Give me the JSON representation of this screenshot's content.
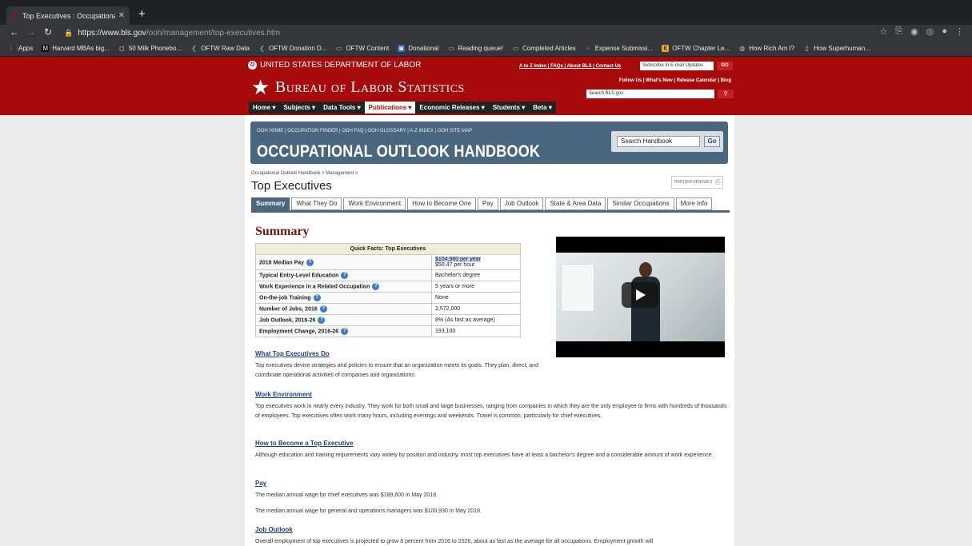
{
  "browser": {
    "tab_title": "Top Executives : Occupational",
    "url_host": "https://www.bls.gov",
    "url_path": "/ooh/management/top-executives.htm",
    "bookmarks": [
      {
        "label": "Apps",
        "icon": "apps-grid-icon"
      },
      {
        "label": "Harvard MBAs big...",
        "icon": "medium-icon"
      },
      {
        "label": "50 Milk Phonebo...",
        "icon": "square-icon"
      },
      {
        "label": "OFTW Raw Data",
        "icon": "oftw-icon"
      },
      {
        "label": "OFTW Donation D...",
        "icon": "oftw-icon"
      },
      {
        "label": "OFTW Content",
        "icon": "folder-icon"
      },
      {
        "label": "Donational",
        "icon": "donational-icon"
      },
      {
        "label": "Reading queue!",
        "icon": "folder-icon"
      },
      {
        "label": "Completed Articles",
        "icon": "folder-icon"
      },
      {
        "label": "Expense Submissi...",
        "icon": "form-icon"
      },
      {
        "label": "OFTW Chapter Le...",
        "icon": "chapter-icon"
      },
      {
        "label": "How Rich Am I?",
        "icon": "globe-icon"
      },
      {
        "label": "How Superhuman...",
        "icon": "page-icon"
      }
    ]
  },
  "bls": {
    "dol": "UNITED STATES DEPARTMENT OF LABOR",
    "toplinks": "A to Z Index | FAQs | About BLS | Contact Us",
    "subscribe_placeholder": "Subscribe to E-mail Updates",
    "go": "GO",
    "title": "Bureau of Labor Statistics",
    "follow": "Follow Us  | What's New | Release Calendar | Blog",
    "search_placeholder": "Search BLS.gov",
    "nav": [
      "Home ▾",
      "Subjects ▾",
      "Data Tools ▾",
      "Publications ▾",
      "Economic Releases ▾",
      "Students ▾",
      "Beta ▾"
    ]
  },
  "ooh": {
    "links": "OOH HOME  |  OCCUPATION FINDER  |  OOH FAQ  |  OOH GLOSSARY  |  A-Z INDEX  |  OOH SITE MAP",
    "title": "OCCUPATIONAL OUTLOOK HANDBOOK",
    "search_value": "Search Handbook",
    "search_go": "Go"
  },
  "page": {
    "breadcrumb": "Occupational Outlook Handbook > Management >",
    "printer": "PRINTER-FRIENDLY",
    "title": "Top Executives",
    "tabs": [
      "Summary",
      "What They Do",
      "Work Environment",
      "How to Become One",
      "Pay",
      "Job Outlook",
      "State & Area Data",
      "Similar Occupations",
      "More Info"
    ],
    "summary_heading": "Summary",
    "quickfacts_header": "Quick Facts: Top Executives",
    "quickfacts": [
      {
        "label": "2018 Median Pay",
        "value": "$104,980 per year",
        "value2": "$50.47 per hour"
      },
      {
        "label": "Typical Entry-Level Education",
        "value": "Bachelor's degree"
      },
      {
        "label": "Work Experience in a Related Occupation",
        "value": "5 years or more"
      },
      {
        "label": "On-the-job Training",
        "value": "None"
      },
      {
        "label": "Number of Jobs, 2016",
        "value": "2,572,000"
      },
      {
        "label": "Job Outlook, 2016-26",
        "value": "8% (As fast as average)"
      },
      {
        "label": "Employment Change, 2016-26",
        "value": "193,100"
      }
    ],
    "sections": [
      {
        "heading": "What Top Executives Do",
        "paras": [
          "Top executives devise strategies and policies to ensure that an organization meets its goals. They plan, direct, and coordinate operational activities of companies and organizations."
        ]
      },
      {
        "heading": "Work Environment",
        "paras": [
          "Top executives work in nearly every industry. They work for both small and large businesses, ranging from companies in which they are the only employee to firms with hundreds of thousands of employees. Top executives often work many hours, including evenings and weekends. Travel is common, particularly for chief executives."
        ]
      },
      {
        "heading": "How to Become a Top Executive",
        "paras": [
          "Although education and training requirements vary widely by position and industry, most top executives have at least a bachelor's degree and a considerable amount of work experience."
        ]
      },
      {
        "heading": "Pay",
        "paras": [
          "The median annual wage for chief executives was $189,600 in May 2018.",
          "The median annual wage for general and operations managers was $100,930 in May 2018."
        ]
      },
      {
        "heading": "Job Outlook",
        "paras": [
          "Overall employment of top executives is projected to grow 8 percent from 2016 to 2026, about as fast as the average for all occupations. Employment growth will"
        ]
      }
    ]
  }
}
